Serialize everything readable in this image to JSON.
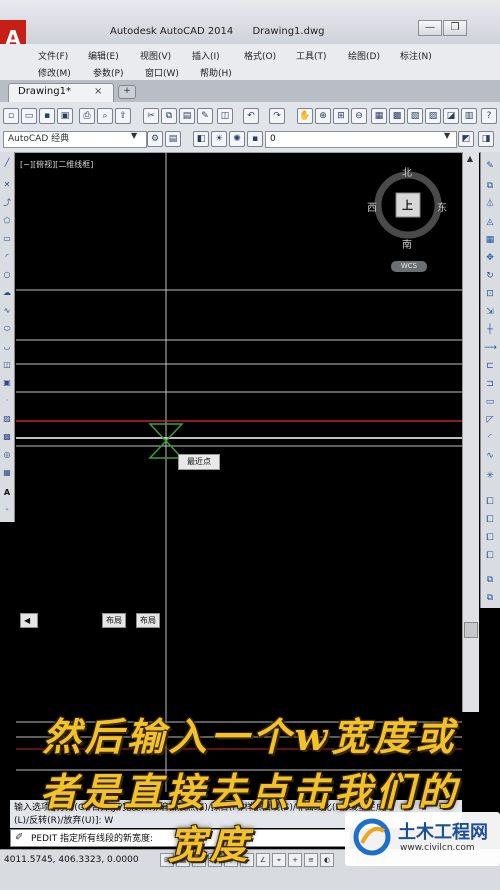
{
  "window": {
    "app_title": "Autodesk AutoCAD 2014",
    "file_name": "Drawing1.dwg",
    "minimize": "—",
    "restore": "❐",
    "logo_letter": "A"
  },
  "menus": {
    "row1": [
      "文件(F)",
      "编辑(E)",
      "视图(V)",
      "插入(I)",
      "格式(O)",
      "工具(T)",
      "绘图(D)",
      "标注(N)"
    ],
    "row2": [
      "修改(M)",
      "参数(P)",
      "窗口(W)",
      "帮助(H)"
    ]
  },
  "tabs": {
    "doc_tab": "Drawing1*",
    "close": "×",
    "new_tab": "+"
  },
  "toolbar": {
    "workspace": "AutoCAD 经典",
    "layer": "0"
  },
  "viewport": {
    "label": "[−][俯视][二维线框]",
    "compass": {
      "north": "北",
      "south": "南",
      "east": "东",
      "west": "西",
      "top": "上"
    },
    "wcs": "WCS",
    "snap_tooltip": "最近点"
  },
  "layout_tabs": [
    "布局",
    "布局"
  ],
  "command": {
    "history_line1": "输入选项 [打开(O)/合并(J)/宽度(W)/编辑顶点(E)/拟合(F)/样条曲线(S)/非曲线化(D)/线型生成",
    "history_line2": "(L)/反转(R)/放弃(U)]: W",
    "prompt": "PEDIT 指定所有线段的新宽度:"
  },
  "status": {
    "coords": "4011.5745, 406.3323, 0.0000"
  },
  "subtitles": [
    "然后输入一个w宽度或",
    "者是直接去点击我们的",
    "宽度"
  ],
  "watermark": {
    "title": "土木工程网",
    "url": "www.civilcn.com"
  },
  "colors": {
    "subtitle": "#f2c22a",
    "canvas": "#000000",
    "red_line": "#c0262a",
    "grid_line": "#bfbfbf"
  }
}
